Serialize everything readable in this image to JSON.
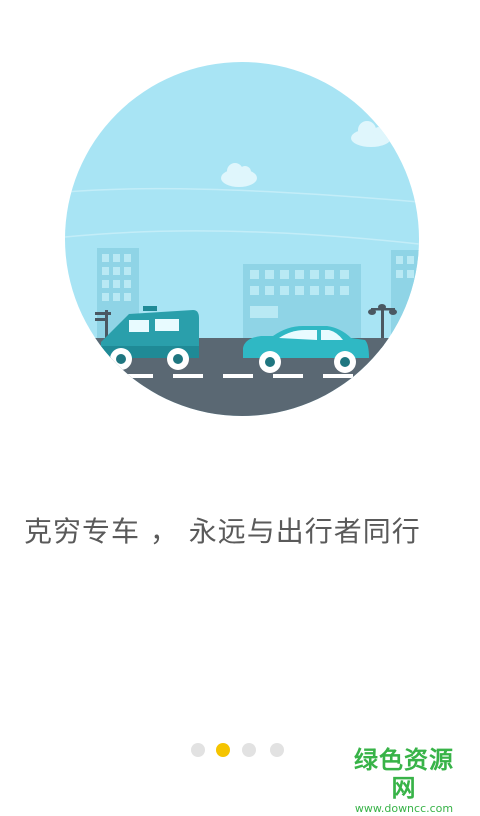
{
  "onboarding": {
    "tagline": "克穷专车 ， 永远与出行者同行",
    "page_indicator": {
      "total": 4,
      "current": 2
    },
    "illustration": {
      "scene_icon": "city-road-cars-illustration",
      "sky_color": "#a8e4f4",
      "road_color": "#5a6873",
      "car_color": "#2fb8c4"
    },
    "accent_color": "#f5c400"
  },
  "watermark": {
    "name": "绿色资源网",
    "url": "www.downcc.com",
    "color": "#38b348"
  }
}
